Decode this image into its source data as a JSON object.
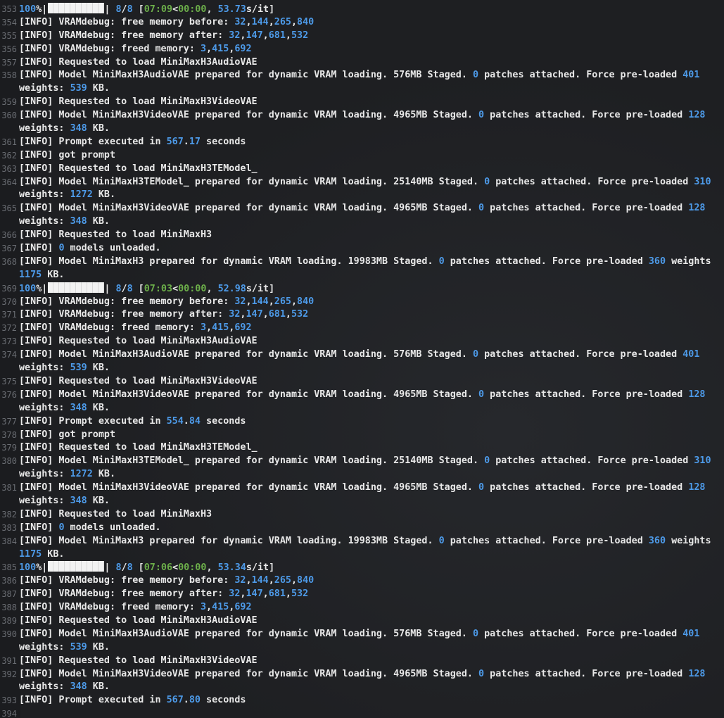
{
  "log": [
    {
      "n": "353",
      "segs": [
        [
          "100",
          "n"
        ],
        [
          "%|",
          ""
        ],
        [
          "",
          "bar"
        ],
        [
          "| ",
          ""
        ],
        [
          "8",
          "n"
        ],
        [
          "/",
          ""
        ],
        [
          "8",
          "n"
        ],
        [
          " [",
          ""
        ],
        [
          "07:09",
          "g"
        ],
        [
          "<",
          ""
        ],
        [
          "00:00",
          "g"
        ],
        [
          ", ",
          ""
        ],
        [
          "53.73",
          "n"
        ],
        [
          "s/it]",
          ""
        ]
      ]
    },
    {
      "n": "354",
      "segs": [
        [
          "[INFO] VRAMdebug: free memory before: ",
          ""
        ],
        [
          "32",
          "n"
        ],
        [
          ",",
          ""
        ],
        [
          "144",
          "n"
        ],
        [
          ",",
          ""
        ],
        [
          "265",
          "n"
        ],
        [
          ",",
          ""
        ],
        [
          "840",
          "n"
        ]
      ]
    },
    {
      "n": "355",
      "segs": [
        [
          "[INFO] VRAMdebug: free memory after: ",
          ""
        ],
        [
          "32",
          "n"
        ],
        [
          ",",
          ""
        ],
        [
          "147",
          "n"
        ],
        [
          ",",
          ""
        ],
        [
          "681",
          "n"
        ],
        [
          ",",
          ""
        ],
        [
          "532",
          "n"
        ]
      ]
    },
    {
      "n": "356",
      "segs": [
        [
          "[INFO] VRAMdebug: freed memory: ",
          ""
        ],
        [
          "3",
          "n"
        ],
        [
          ",",
          ""
        ],
        [
          "415",
          "n"
        ],
        [
          ",",
          ""
        ],
        [
          "692",
          "n"
        ]
      ]
    },
    {
      "n": "357",
      "segs": [
        [
          "[INFO] Requested to load MiniMaxH3AudioVAE",
          ""
        ]
      ]
    },
    {
      "n": "358",
      "segs": [
        [
          "[INFO] Model MiniMaxH3AudioVAE prepared for dynamic VRAM loading. 576MB Staged. ",
          ""
        ],
        [
          "0",
          "n"
        ],
        [
          " patches attached. Force pre-loaded ",
          ""
        ],
        [
          "401",
          "n"
        ]
      ]
    },
    {
      "n": "",
      "segs": [
        [
          "weights: ",
          ""
        ],
        [
          "539",
          "n"
        ],
        [
          " KB.",
          ""
        ]
      ]
    },
    {
      "n": "359",
      "segs": [
        [
          "[INFO] Requested to load MiniMaxH3VideoVAE",
          ""
        ]
      ]
    },
    {
      "n": "360",
      "segs": [
        [
          "[INFO] Model MiniMaxH3VideoVAE prepared for dynamic VRAM loading. 4965MB Staged. ",
          ""
        ],
        [
          "0",
          "n"
        ],
        [
          " patches attached. Force pre-loaded ",
          ""
        ],
        [
          "128",
          "n"
        ]
      ]
    },
    {
      "n": "",
      "segs": [
        [
          "weights: ",
          ""
        ],
        [
          "348",
          "n"
        ],
        [
          " KB.",
          ""
        ]
      ]
    },
    {
      "n": "361",
      "segs": [
        [
          "[INFO] Prompt executed in ",
          ""
        ],
        [
          "567",
          "n"
        ],
        [
          ".",
          ""
        ],
        [
          "17",
          "n"
        ],
        [
          " seconds",
          ""
        ]
      ]
    },
    {
      "n": "362",
      "segs": [
        [
          "[INFO] got prompt",
          ""
        ]
      ]
    },
    {
      "n": "363",
      "segs": [
        [
          "[INFO] Requested to load MiniMaxH3TEModel_",
          ""
        ]
      ]
    },
    {
      "n": "364",
      "segs": [
        [
          "[INFO] Model MiniMaxH3TEModel_ prepared for dynamic VRAM loading. 25140MB Staged. ",
          ""
        ],
        [
          "0",
          "n"
        ],
        [
          " patches attached. Force pre-loaded ",
          ""
        ],
        [
          "310",
          "n"
        ]
      ]
    },
    {
      "n": "",
      "segs": [
        [
          "weights: ",
          ""
        ],
        [
          "1272",
          "n"
        ],
        [
          " KB.",
          ""
        ]
      ]
    },
    {
      "n": "365",
      "segs": [
        [
          "[INFO] Model MiniMaxH3VideoVAE prepared for dynamic VRAM loading. 4965MB Staged. ",
          ""
        ],
        [
          "0",
          "n"
        ],
        [
          " patches attached. Force pre-loaded ",
          ""
        ],
        [
          "128",
          "n"
        ]
      ]
    },
    {
      "n": "",
      "segs": [
        [
          "weights: ",
          ""
        ],
        [
          "348",
          "n"
        ],
        [
          " KB.",
          ""
        ]
      ]
    },
    {
      "n": "366",
      "segs": [
        [
          "[INFO] Requested to load MiniMaxH3",
          ""
        ]
      ]
    },
    {
      "n": "367",
      "segs": [
        [
          "[INFO] ",
          ""
        ],
        [
          "0",
          "n"
        ],
        [
          " models unloaded.",
          ""
        ]
      ]
    },
    {
      "n": "368",
      "segs": [
        [
          "[INFO] Model MiniMaxH3 prepared for dynamic VRAM loading. 19983MB Staged. ",
          ""
        ],
        [
          "0",
          "n"
        ],
        [
          " patches attached. Force pre-loaded ",
          ""
        ],
        [
          "360",
          "n"
        ],
        [
          " weights",
          ""
        ]
      ]
    },
    {
      "n": "",
      "segs": [
        [
          "1175",
          "n"
        ],
        [
          " KB.",
          ""
        ]
      ]
    },
    {
      "n": "369",
      "segs": [
        [
          "100",
          "n"
        ],
        [
          "%|",
          ""
        ],
        [
          "",
          "bar"
        ],
        [
          "| ",
          ""
        ],
        [
          "8",
          "n"
        ],
        [
          "/",
          ""
        ],
        [
          "8",
          "n"
        ],
        [
          " [",
          ""
        ],
        [
          "07:03",
          "g"
        ],
        [
          "<",
          ""
        ],
        [
          "00:00",
          "g"
        ],
        [
          ", ",
          ""
        ],
        [
          "52.98",
          "n"
        ],
        [
          "s/it]",
          ""
        ]
      ]
    },
    {
      "n": "370",
      "segs": [
        [
          "[INFO] VRAMdebug: free memory before: ",
          ""
        ],
        [
          "32",
          "n"
        ],
        [
          ",",
          ""
        ],
        [
          "144",
          "n"
        ],
        [
          ",",
          ""
        ],
        [
          "265",
          "n"
        ],
        [
          ",",
          ""
        ],
        [
          "840",
          "n"
        ]
      ]
    },
    {
      "n": "371",
      "segs": [
        [
          "[INFO] VRAMdebug: free memory after: ",
          ""
        ],
        [
          "32",
          "n"
        ],
        [
          ",",
          ""
        ],
        [
          "147",
          "n"
        ],
        [
          ",",
          ""
        ],
        [
          "681",
          "n"
        ],
        [
          ",",
          ""
        ],
        [
          "532",
          "n"
        ]
      ]
    },
    {
      "n": "372",
      "segs": [
        [
          "[INFO] VRAMdebug: freed memory: ",
          ""
        ],
        [
          "3",
          "n"
        ],
        [
          ",",
          ""
        ],
        [
          "415",
          "n"
        ],
        [
          ",",
          ""
        ],
        [
          "692",
          "n"
        ]
      ]
    },
    {
      "n": "373",
      "segs": [
        [
          "[INFO] Requested to load MiniMaxH3AudioVAE",
          ""
        ]
      ]
    },
    {
      "n": "374",
      "segs": [
        [
          "[INFO] Model MiniMaxH3AudioVAE prepared for dynamic VRAM loading. 576MB Staged. ",
          ""
        ],
        [
          "0",
          "n"
        ],
        [
          " patches attached. Force pre-loaded ",
          ""
        ],
        [
          "401",
          "n"
        ]
      ]
    },
    {
      "n": "",
      "segs": [
        [
          "weights: ",
          ""
        ],
        [
          "539",
          "n"
        ],
        [
          " KB.",
          ""
        ]
      ]
    },
    {
      "n": "375",
      "segs": [
        [
          "[INFO] Requested to load MiniMaxH3VideoVAE",
          ""
        ]
      ]
    },
    {
      "n": "376",
      "segs": [
        [
          "[INFO] Model MiniMaxH3VideoVAE prepared for dynamic VRAM loading. 4965MB Staged. ",
          ""
        ],
        [
          "0",
          "n"
        ],
        [
          " patches attached. Force pre-loaded ",
          ""
        ],
        [
          "128",
          "n"
        ]
      ]
    },
    {
      "n": "",
      "segs": [
        [
          "weights: ",
          ""
        ],
        [
          "348",
          "n"
        ],
        [
          " KB.",
          ""
        ]
      ]
    },
    {
      "n": "377",
      "segs": [
        [
          "[INFO] Prompt executed in ",
          ""
        ],
        [
          "554",
          "n"
        ],
        [
          ".",
          ""
        ],
        [
          "84",
          "n"
        ],
        [
          " seconds",
          ""
        ]
      ]
    },
    {
      "n": "378",
      "segs": [
        [
          "[INFO] got prompt",
          ""
        ]
      ]
    },
    {
      "n": "379",
      "segs": [
        [
          "[INFO] Requested to load MiniMaxH3TEModel_",
          ""
        ]
      ]
    },
    {
      "n": "380",
      "segs": [
        [
          "[INFO] Model MiniMaxH3TEModel_ prepared for dynamic VRAM loading. 25140MB Staged. ",
          ""
        ],
        [
          "0",
          "n"
        ],
        [
          " patches attached. Force pre-loaded ",
          ""
        ],
        [
          "310",
          "n"
        ]
      ]
    },
    {
      "n": "",
      "segs": [
        [
          "weights: ",
          ""
        ],
        [
          "1272",
          "n"
        ],
        [
          " KB.",
          ""
        ]
      ]
    },
    {
      "n": "381",
      "segs": [
        [
          "[INFO] Model MiniMaxH3VideoVAE prepared for dynamic VRAM loading. 4965MB Staged. ",
          ""
        ],
        [
          "0",
          "n"
        ],
        [
          " patches attached. Force pre-loaded ",
          ""
        ],
        [
          "128",
          "n"
        ]
      ]
    },
    {
      "n": "",
      "segs": [
        [
          "weights: ",
          ""
        ],
        [
          "348",
          "n"
        ],
        [
          " KB.",
          ""
        ]
      ]
    },
    {
      "n": "382",
      "segs": [
        [
          "[INFO] Requested to load MiniMaxH3",
          ""
        ]
      ]
    },
    {
      "n": "383",
      "segs": [
        [
          "[INFO] ",
          ""
        ],
        [
          "0",
          "n"
        ],
        [
          " models unloaded.",
          ""
        ]
      ]
    },
    {
      "n": "384",
      "segs": [
        [
          "[INFO] Model MiniMaxH3 prepared for dynamic VRAM loading. 19983MB Staged. ",
          ""
        ],
        [
          "0",
          "n"
        ],
        [
          " patches attached. Force pre-loaded ",
          ""
        ],
        [
          "360",
          "n"
        ],
        [
          " weights",
          ""
        ]
      ]
    },
    {
      "n": "",
      "segs": [
        [
          "1175",
          "n"
        ],
        [
          " KB.",
          ""
        ]
      ]
    },
    {
      "n": "385",
      "segs": [
        [
          "100",
          "n"
        ],
        [
          "%|",
          ""
        ],
        [
          "",
          "bar"
        ],
        [
          "| ",
          ""
        ],
        [
          "8",
          "n"
        ],
        [
          "/",
          ""
        ],
        [
          "8",
          "n"
        ],
        [
          " [",
          ""
        ],
        [
          "07:06",
          "g"
        ],
        [
          "<",
          ""
        ],
        [
          "00:00",
          "g"
        ],
        [
          ", ",
          ""
        ],
        [
          "53.34",
          "n"
        ],
        [
          "s/it]",
          ""
        ]
      ]
    },
    {
      "n": "386",
      "segs": [
        [
          "[INFO] VRAMdebug: free memory before: ",
          ""
        ],
        [
          "32",
          "n"
        ],
        [
          ",",
          ""
        ],
        [
          "144",
          "n"
        ],
        [
          ",",
          ""
        ],
        [
          "265",
          "n"
        ],
        [
          ",",
          ""
        ],
        [
          "840",
          "n"
        ]
      ]
    },
    {
      "n": "387",
      "segs": [
        [
          "[INFO] VRAMdebug: free memory after: ",
          ""
        ],
        [
          "32",
          "n"
        ],
        [
          ",",
          ""
        ],
        [
          "147",
          "n"
        ],
        [
          ",",
          ""
        ],
        [
          "681",
          "n"
        ],
        [
          ",",
          ""
        ],
        [
          "532",
          "n"
        ]
      ]
    },
    {
      "n": "388",
      "segs": [
        [
          "[INFO] VRAMdebug: freed memory: ",
          ""
        ],
        [
          "3",
          "n"
        ],
        [
          ",",
          ""
        ],
        [
          "415",
          "n"
        ],
        [
          ",",
          ""
        ],
        [
          "692",
          "n"
        ]
      ]
    },
    {
      "n": "389",
      "segs": [
        [
          "[INFO] Requested to load MiniMaxH3AudioVAE",
          ""
        ]
      ]
    },
    {
      "n": "390",
      "segs": [
        [
          "[INFO] Model MiniMaxH3AudioVAE prepared for dynamic VRAM loading. 576MB Staged. ",
          ""
        ],
        [
          "0",
          "n"
        ],
        [
          " patches attached. Force pre-loaded ",
          ""
        ],
        [
          "401",
          "n"
        ]
      ]
    },
    {
      "n": "",
      "segs": [
        [
          "weights: ",
          ""
        ],
        [
          "539",
          "n"
        ],
        [
          " KB.",
          ""
        ]
      ]
    },
    {
      "n": "391",
      "segs": [
        [
          "[INFO] Requested to load MiniMaxH3VideoVAE",
          ""
        ]
      ]
    },
    {
      "n": "392",
      "segs": [
        [
          "[INFO] Model MiniMaxH3VideoVAE prepared for dynamic VRAM loading. 4965MB Staged. ",
          ""
        ],
        [
          "0",
          "n"
        ],
        [
          " patches attached. Force pre-loaded ",
          ""
        ],
        [
          "128",
          "n"
        ]
      ]
    },
    {
      "n": "",
      "segs": [
        [
          "weights: ",
          ""
        ],
        [
          "348",
          "n"
        ],
        [
          " KB.",
          ""
        ]
      ]
    },
    {
      "n": "393",
      "segs": [
        [
          "[INFO] Prompt executed in ",
          ""
        ],
        [
          "567",
          "n"
        ],
        [
          ".",
          ""
        ],
        [
          "80",
          "n"
        ],
        [
          " seconds",
          ""
        ]
      ]
    },
    {
      "n": "394",
      "segs": []
    }
  ]
}
